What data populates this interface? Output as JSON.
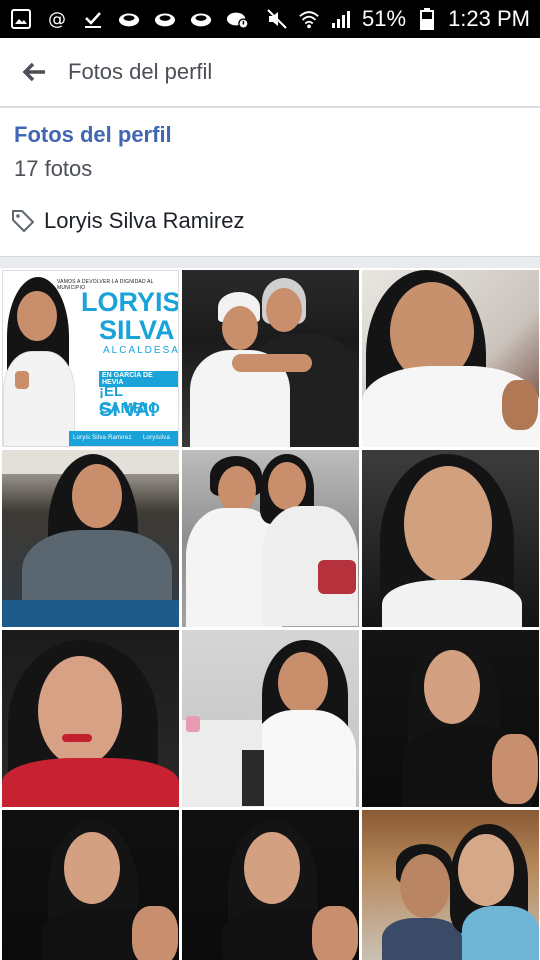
{
  "status_bar": {
    "battery": "51%",
    "time": "1:23 PM",
    "icons": [
      "image-icon",
      "at-icon",
      "check-download-icon",
      "cloud-icon",
      "cloud-icon",
      "cloud-icon",
      "alert-cloud-icon",
      "mute-icon",
      "wifi-icon",
      "signal-icon",
      "battery-icon"
    ]
  },
  "header": {
    "title": "Fotos del perfil",
    "back_icon": "back-arrow-icon"
  },
  "album": {
    "title": "Fotos del perfil",
    "count": "17 fotos",
    "tagged": "Loryis Silva Ramirez"
  },
  "poster": {
    "top_line": "VAMOS A DEVOLVER LA DIGNIDAD AL MUNICIPIO",
    "name1": "LORYIS",
    "name2": "SILVA",
    "role": "ALCALDESA",
    "place": "EN GARCÍA DE HEVIA",
    "slogan1": "¡EL CAMBIO",
    "slogan2": "SI VA!",
    "footer1": "Loryis Silva Ramirez",
    "footer2": "Loryisilva"
  },
  "photos": [
    {
      "name": "profile-photo-1"
    },
    {
      "name": "profile-photo-2"
    },
    {
      "name": "profile-photo-3"
    },
    {
      "name": "profile-photo-4"
    },
    {
      "name": "profile-photo-5"
    },
    {
      "name": "profile-photo-6"
    },
    {
      "name": "profile-photo-7"
    },
    {
      "name": "profile-photo-8"
    },
    {
      "name": "profile-photo-9"
    },
    {
      "name": "profile-photo-10"
    },
    {
      "name": "profile-photo-11"
    },
    {
      "name": "profile-photo-12"
    }
  ],
  "colors": {
    "link_blue": "#4267b2",
    "poster_blue": "#1aa3d9",
    "divider": "#e9ebee"
  }
}
